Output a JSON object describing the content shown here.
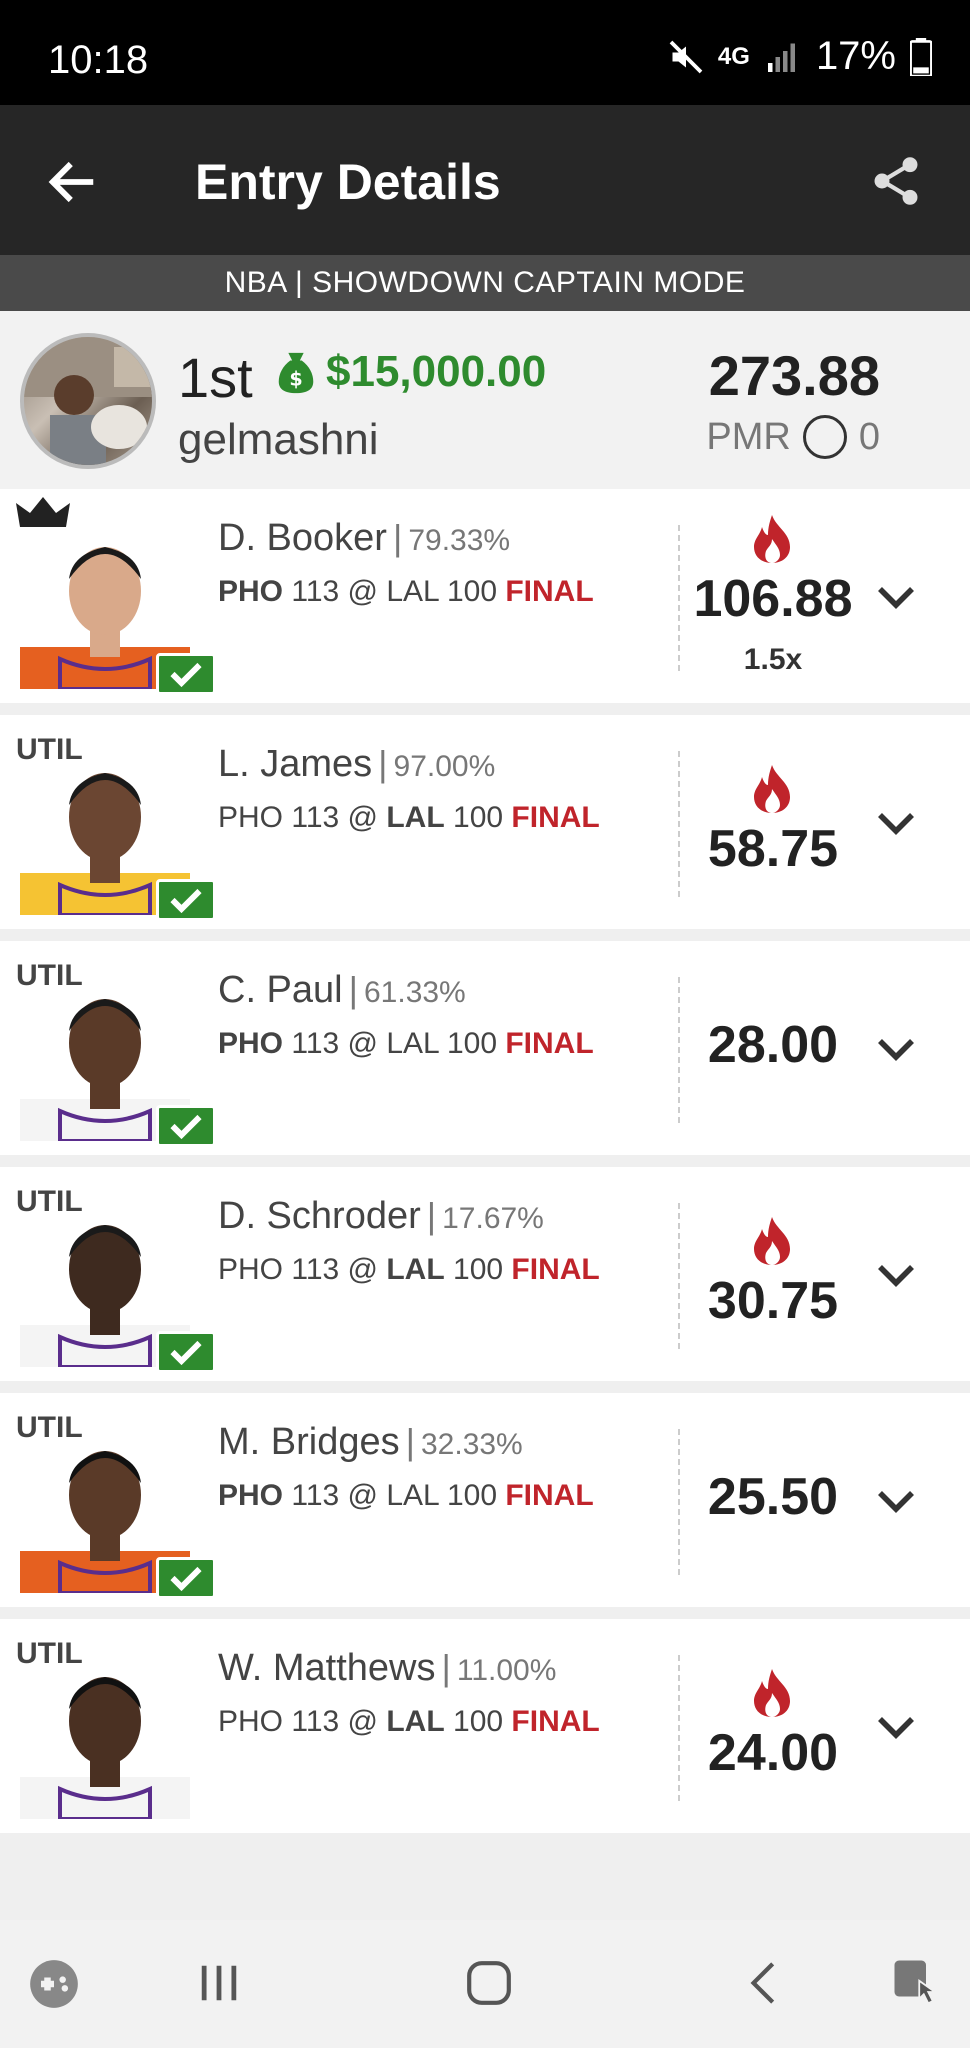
{
  "status_bar": {
    "time": "10:18",
    "network": "4G",
    "battery": "17%",
    "icons": [
      "mute-icon",
      "network-icon",
      "signal-icon",
      "battery-icon"
    ]
  },
  "app_bar": {
    "title": "Entry Details",
    "back_icon": "arrow-left-icon",
    "share_icon": "share-icon"
  },
  "contest_header": "NBA | SHOWDOWN CAPTAIN MODE",
  "entry": {
    "rank": "1st",
    "prize": "$15,000.00",
    "username": "gelmashni",
    "total_points": "273.88",
    "pmr_label": "PMR",
    "pmr_value": "0"
  },
  "players": [
    {
      "position": "",
      "captain": true,
      "name": "D. Booker",
      "owned": "79.33%",
      "team_a": "PHO",
      "score_a": "113",
      "at": "@",
      "team_b": "LAL",
      "score_b": "100",
      "bold_team": "a",
      "status": "FINAL",
      "points": "106.88",
      "multiplier": "1.5x",
      "hot": true,
      "checked": true,
      "jersey": "#e56020"
    },
    {
      "position": "UTIL",
      "captain": false,
      "name": "L. James",
      "owned": "97.00%",
      "team_a": "PHO",
      "score_a": "113",
      "at": "@",
      "team_b": "LAL",
      "score_b": "100",
      "bold_team": "b",
      "status": "FINAL",
      "points": "58.75",
      "multiplier": "",
      "hot": true,
      "checked": true,
      "jersey": "#f5c333"
    },
    {
      "position": "UTIL",
      "captain": false,
      "name": "C. Paul",
      "owned": "61.33%",
      "team_a": "PHO",
      "score_a": "113",
      "at": "@",
      "team_b": "LAL",
      "score_b": "100",
      "bold_team": "a",
      "status": "FINAL",
      "points": "28.00",
      "multiplier": "",
      "hot": false,
      "checked": true,
      "jersey": "#f4f4f4"
    },
    {
      "position": "UTIL",
      "captain": false,
      "name": "D. Schroder",
      "owned": "17.67%",
      "team_a": "PHO",
      "score_a": "113",
      "at": "@",
      "team_b": "LAL",
      "score_b": "100",
      "bold_team": "b",
      "status": "FINAL",
      "points": "30.75",
      "multiplier": "",
      "hot": true,
      "checked": true,
      "jersey": "#f4f4f4"
    },
    {
      "position": "UTIL",
      "captain": false,
      "name": "M. Bridges",
      "owned": "32.33%",
      "team_a": "PHO",
      "score_a": "113",
      "at": "@",
      "team_b": "LAL",
      "score_b": "100",
      "bold_team": "a",
      "status": "FINAL",
      "points": "25.50",
      "multiplier": "",
      "hot": false,
      "checked": true,
      "jersey": "#e56020"
    },
    {
      "position": "UTIL",
      "captain": false,
      "name": "W. Matthews",
      "owned": "11.00%",
      "team_a": "PHO",
      "score_a": "113",
      "at": "@",
      "team_b": "LAL",
      "score_b": "100",
      "bold_team": "b",
      "status": "FINAL",
      "points": "24.00",
      "multiplier": "",
      "hot": true,
      "checked": false,
      "jersey": "#f4f4f4"
    }
  ],
  "colors": {
    "prize_green": "#2e8b2e",
    "final_red": "#c0242b",
    "fire_red": "#c0242b",
    "app_bar": "#262626",
    "subheader": "#4a4a4a"
  },
  "nav_bar": {
    "icons": [
      "game-launcher-icon",
      "recent-apps-icon",
      "home-icon",
      "back-icon",
      "accessibility-icon"
    ]
  }
}
